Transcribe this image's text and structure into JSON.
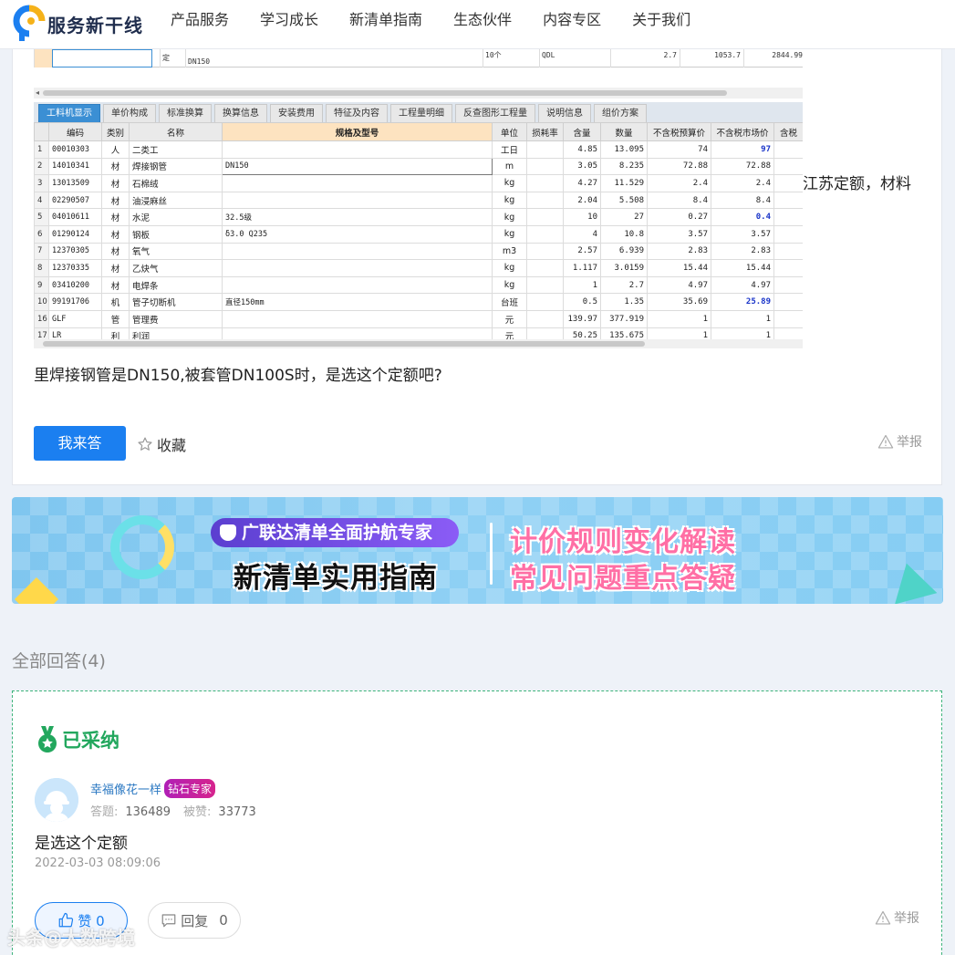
{
  "header": {
    "logo_text": "服务新干线",
    "nav": [
      "产品服务",
      "学习成长",
      "新清单指南",
      "生态伙伴",
      "内容专区",
      "关于我们"
    ]
  },
  "question": {
    "prev_row": {
      "type": "定",
      "spec": "DN150",
      "unit": "10个",
      "code": "QDL",
      "v1": "2.7",
      "v2": "1053.7",
      "v3": "2844.99"
    },
    "tabs": [
      "工料机显示",
      "单价构成",
      "标准换算",
      "换算信息",
      "安装费用",
      "特征及内容",
      "工程量明细",
      "反查图形工程量",
      "说明信息",
      "组价方案"
    ],
    "columns": [
      "编码",
      "类别",
      "名称",
      "规格及型号",
      "单位",
      "损耗率",
      "含量",
      "数量",
      "不含税预算价",
      "不含税市场价",
      "含税"
    ],
    "rows": [
      {
        "no": "1",
        "code": "00010303",
        "cat": "人",
        "name": "二类工",
        "spec": "",
        "unit": "工日",
        "loss": "",
        "qty": "4.85",
        "amt": "13.095",
        "budget": "74",
        "market": "97",
        "hl": true
      },
      {
        "no": "2",
        "code": "14010341",
        "cat": "材",
        "name": "焊接钢管",
        "spec": "DN150",
        "unit": "m",
        "loss": "",
        "qty": "3.05",
        "amt": "8.235",
        "budget": "72.88",
        "market": "72.88",
        "hl": false
      },
      {
        "no": "3",
        "code": "13013509",
        "cat": "材",
        "name": "石棉绒",
        "spec": "",
        "unit": "kg",
        "loss": "",
        "qty": "4.27",
        "amt": "11.529",
        "budget": "2.4",
        "market": "2.4",
        "hl": false
      },
      {
        "no": "4",
        "code": "02290507",
        "cat": "材",
        "name": "油浸麻丝",
        "spec": "",
        "unit": "kg",
        "loss": "",
        "qty": "2.04",
        "amt": "5.508",
        "budget": "8.4",
        "market": "8.4",
        "hl": false
      },
      {
        "no": "5",
        "code": "04010611",
        "cat": "材",
        "name": "水泥",
        "spec": "32.5级",
        "unit": "kg",
        "loss": "",
        "qty": "10",
        "amt": "27",
        "budget": "0.27",
        "market": "0.4",
        "hl": true
      },
      {
        "no": "6",
        "code": "01290124",
        "cat": "材",
        "name": "钢板",
        "spec": "δ3.0 Q235",
        "unit": "kg",
        "loss": "",
        "qty": "4",
        "amt": "10.8",
        "budget": "3.57",
        "market": "3.57",
        "hl": false
      },
      {
        "no": "7",
        "code": "12370305",
        "cat": "材",
        "name": "氧气",
        "spec": "",
        "unit": "m3",
        "loss": "",
        "qty": "2.57",
        "amt": "6.939",
        "budget": "2.83",
        "market": "2.83",
        "hl": false
      },
      {
        "no": "8",
        "code": "12370335",
        "cat": "材",
        "name": "乙炔气",
        "spec": "",
        "unit": "kg",
        "loss": "",
        "qty": "1.117",
        "amt": "3.0159",
        "budget": "15.44",
        "market": "15.44",
        "hl": false
      },
      {
        "no": "9",
        "code": "03410200",
        "cat": "材",
        "name": "电焊条",
        "spec": "",
        "unit": "kg",
        "loss": "",
        "qty": "1",
        "amt": "2.7",
        "budget": "4.97",
        "market": "4.97",
        "hl": false
      },
      {
        "no": "10",
        "code": "99191706",
        "cat": "机",
        "name": "管子切断机",
        "spec": "直径150mm",
        "unit": "台班",
        "loss": "",
        "qty": "0.5",
        "amt": "1.35",
        "budget": "35.69",
        "market": "25.89",
        "hl": true
      },
      {
        "no": "16",
        "code": "GLF",
        "cat": "管",
        "name": "管理费",
        "spec": "",
        "unit": "元",
        "loss": "",
        "qty": "139.97",
        "amt": "377.919",
        "budget": "1",
        "market": "1",
        "hl": false
      },
      {
        "no": "17",
        "code": "LR",
        "cat": "利",
        "name": "利润",
        "spec": "",
        "unit": "元",
        "loss": "",
        "qty": "50.25",
        "amt": "135.675",
        "budget": "1",
        "market": "1",
        "hl": false
      }
    ],
    "text_side": "江苏定额，材料",
    "text_line2": "里焊接钢管是DN150,被套管DN100S时，是选这个定额吧?",
    "answer_button": "我来答",
    "favorite": "收藏",
    "report": "举报"
  },
  "banner": {
    "pill": "广联达清单全面护航专家",
    "main": "新清单实用指南",
    "right1": "计价规则变化解读",
    "right2": "常见问题重点答疑"
  },
  "answers": {
    "title": "全部回答(4)",
    "accepted_label": "已采纳",
    "user": "幸福像花一样",
    "badge": "钻石专家",
    "answers_label": "答题:",
    "answers_count": "136489",
    "likes_label": "被赞:",
    "likes_count": "33773",
    "content": "是选这个定额",
    "time": "2022-03-03 08:09:06",
    "like_label": "赞 0",
    "reply_label": "回复",
    "reply_count": "0",
    "report": "举报"
  },
  "watermark": "头条@大数跨境",
  "colors": {
    "primary": "#1b7ff0",
    "accepted": "#22a75d",
    "badge": "#c41fa8"
  }
}
